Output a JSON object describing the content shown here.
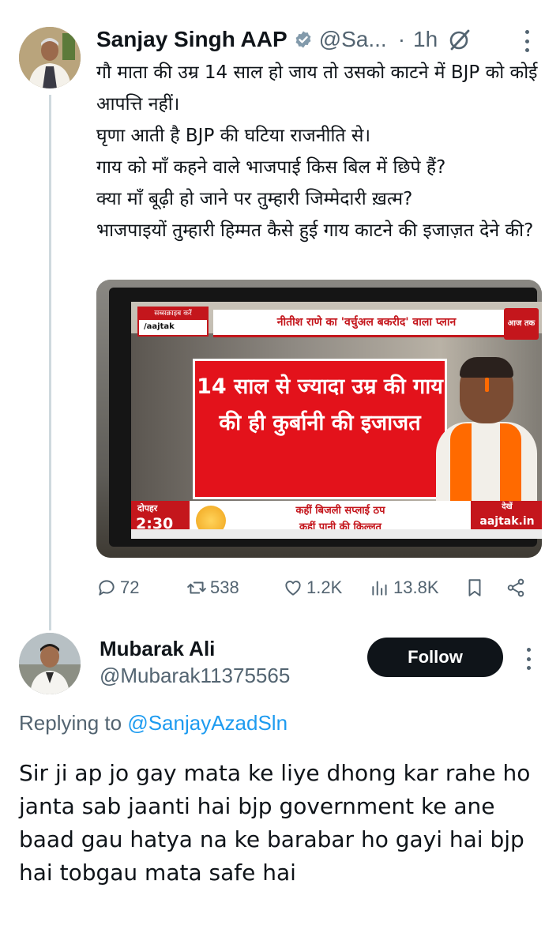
{
  "tweet": {
    "author_name": "Sanjay Singh AAP",
    "handle": "@Sa...",
    "separator": "·",
    "time": "1h",
    "text": "गौ माता की उम्र 14 साल हो जाय तो उसको काटने में BJP को कोई आपत्ति नहीं।\nघृणा आती है BJP की घटिया राजनीति से।\nगाय को माँ कहने वाले भाजपाई किस बिल में छिपे हैं?\nक्या माँ बूढ़ी हो जाने पर तुम्हारी जिम्मेदारी ख़त्म?\nभाजपाइयों तुम्हारी हिम्मत कैसे हुई गाय काटने की इजाज़त देने की?",
    "media": {
      "subscribe_label": "सब्सक्राइब करें",
      "subscribe_handle": "/aajtak",
      "headline": "नीतीश राणे का 'वर्चुअल बकरीद' वाला प्लान",
      "channel_logo": "आज तक",
      "main_text": "14 साल से ज्यादा उम्र की गाय की ही कुर्बानी की इजाजत",
      "time_label": "दोपहर",
      "time_value": "2:30 बजे",
      "ticker_line1": "कहीं बिजली सप्लाई ठप",
      "ticker_line2": "कहीं पानी की किल्लत",
      "watch_label": "देखें",
      "watch_site": "aajtak.in"
    },
    "stats": {
      "replies": "72",
      "reposts": "538",
      "likes": "1.2K",
      "views": "13.8K"
    }
  },
  "reply": {
    "author_name": "Mubarak Ali",
    "handle": "@Mubarak11375565",
    "follow_label": "Follow",
    "replying_prefix": "Replying to",
    "replying_handle": "@SanjayAzadSln",
    "text": "Sir ji ap jo gay mata ke liye dhong kar rahe ho janta sab jaanti hai bjp government ke ane baad gau hatya na ke barabar ho gayi hai bjp hai tobgau mata safe hai"
  },
  "colors": {
    "text_primary": "#0f1419",
    "text_secondary": "#536471",
    "verified_badge": "#829aab",
    "link": "#1d9bf0",
    "follow_bg": "#0f1419"
  }
}
